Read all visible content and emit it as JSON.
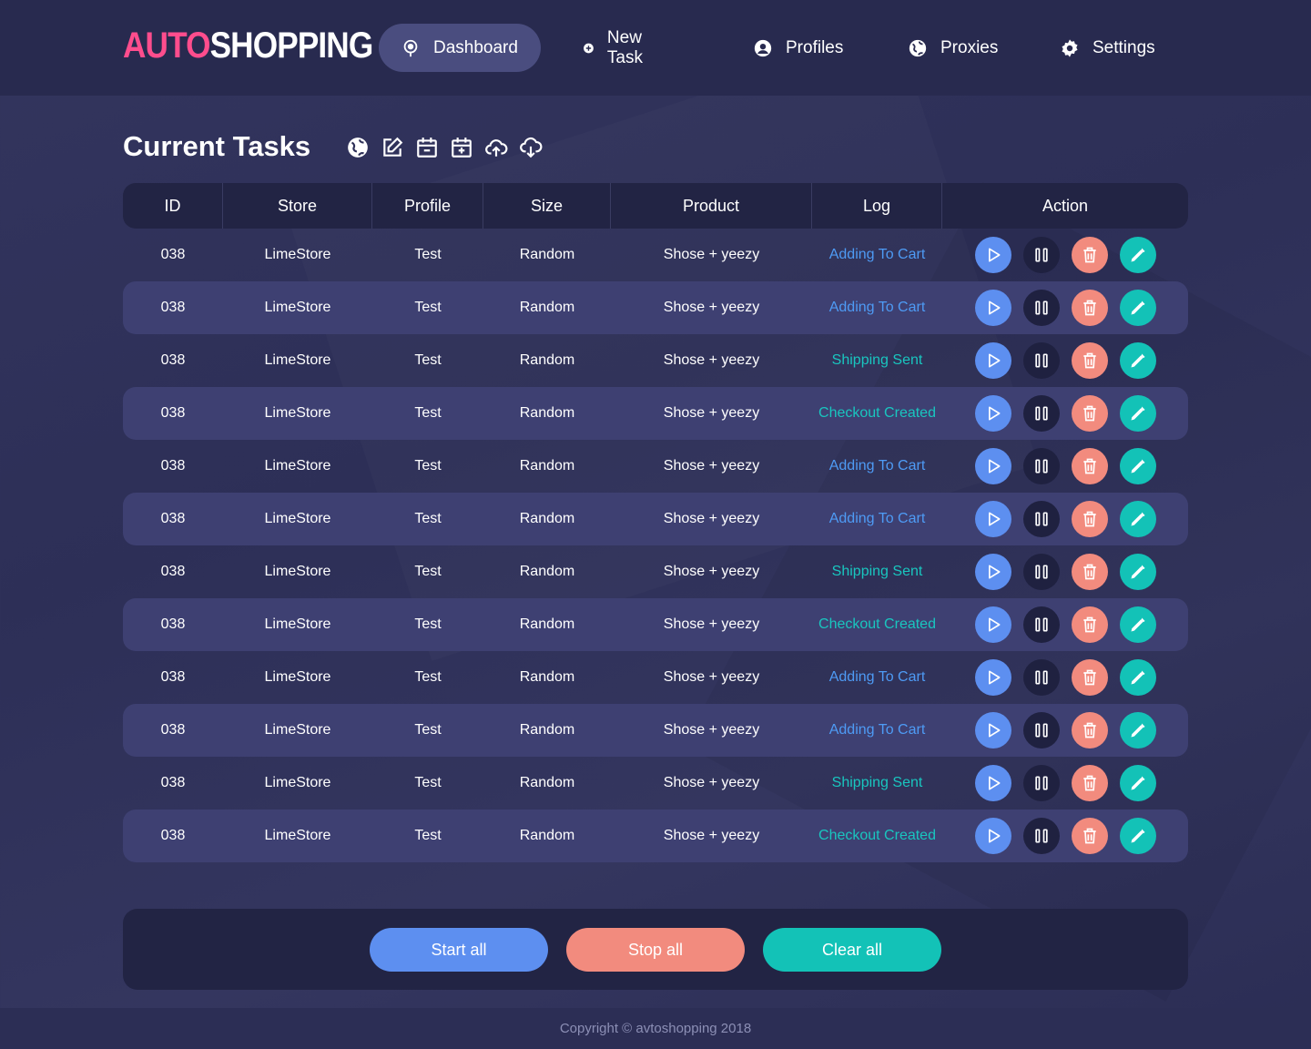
{
  "brand": {
    "part1": "AUTO",
    "part2": "SHOPPING",
    "accent_color": "#ff4d8d"
  },
  "nav": {
    "items": [
      {
        "label": "Dashboard",
        "icon": "dashboard-pin-icon",
        "active": true
      },
      {
        "label": "New Task",
        "icon": "plus-circle-icon",
        "active": false
      },
      {
        "label": "Profiles",
        "icon": "user-circle-icon",
        "active": false
      },
      {
        "label": "Proxies",
        "icon": "globe-icon",
        "active": false
      },
      {
        "label": "Settings",
        "icon": "gear-icon",
        "active": false
      }
    ]
  },
  "page": {
    "title": "Current Tasks",
    "tool_icons": [
      "globe-icon",
      "edit-icon",
      "calendar-minus-icon",
      "calendar-plus-icon",
      "cloud-upload-icon",
      "cloud-download-icon"
    ]
  },
  "table": {
    "headers": {
      "id": "ID",
      "store": "Store",
      "profile": "Profile",
      "size": "Size",
      "product": "Product",
      "log": "Log",
      "action": "Action"
    },
    "rows": [
      {
        "id": "038",
        "store": "LimeStore",
        "profile": "Test",
        "size": "Random",
        "product": "Shose + yeezy",
        "log": "Adding To Cart",
        "log_color": "#4e9bf5"
      },
      {
        "id": "038",
        "store": "LimeStore",
        "profile": "Test",
        "size": "Random",
        "product": "Shose + yeezy",
        "log": "Adding To Cart",
        "log_color": "#4e9bf5"
      },
      {
        "id": "038",
        "store": "LimeStore",
        "profile": "Test",
        "size": "Random",
        "product": "Shose + yeezy",
        "log": "Shipping Sent",
        "log_color": "#19c6bf"
      },
      {
        "id": "038",
        "store": "LimeStore",
        "profile": "Test",
        "size": "Random",
        "product": "Shose + yeezy",
        "log": "Checkout Created",
        "log_color": "#19c6bf"
      },
      {
        "id": "038",
        "store": "LimeStore",
        "profile": "Test",
        "size": "Random",
        "product": "Shose + yeezy",
        "log": "Adding To Cart",
        "log_color": "#4e9bf5"
      },
      {
        "id": "038",
        "store": "LimeStore",
        "profile": "Test",
        "size": "Random",
        "product": "Shose + yeezy",
        "log": "Adding To Cart",
        "log_color": "#4e9bf5"
      },
      {
        "id": "038",
        "store": "LimeStore",
        "profile": "Test",
        "size": "Random",
        "product": "Shose + yeezy",
        "log": "Shipping Sent",
        "log_color": "#19c6bf"
      },
      {
        "id": "038",
        "store": "LimeStore",
        "profile": "Test",
        "size": "Random",
        "product": "Shose + yeezy",
        "log": "Checkout Created",
        "log_color": "#19c6bf"
      },
      {
        "id": "038",
        "store": "LimeStore",
        "profile": "Test",
        "size": "Random",
        "product": "Shose + yeezy",
        "log": "Adding To Cart",
        "log_color": "#4e9bf5"
      },
      {
        "id": "038",
        "store": "LimeStore",
        "profile": "Test",
        "size": "Random",
        "product": "Shose + yeezy",
        "log": "Adding To Cart",
        "log_color": "#4e9bf5"
      },
      {
        "id": "038",
        "store": "LimeStore",
        "profile": "Test",
        "size": "Random",
        "product": "Shose + yeezy",
        "log": "Shipping Sent",
        "log_color": "#19c6bf"
      },
      {
        "id": "038",
        "store": "LimeStore",
        "profile": "Test",
        "size": "Random",
        "product": "Shose + yeezy",
        "log": "Checkout Created",
        "log_color": "#19c6bf"
      }
    ],
    "action_icons": [
      "play-icon",
      "pause-icon",
      "trash-icon",
      "pencil-icon"
    ]
  },
  "bottom": {
    "start_all": "Start all",
    "stop_all": "Stop all",
    "clear_all": "Clear all"
  },
  "footer": {
    "copyright": "Copyright © avtoshopping 2018"
  },
  "colors": {
    "play": "#5d8ff0",
    "pause": "#1f2140",
    "delete": "#f28b7e",
    "edit": "#13c2b7"
  }
}
